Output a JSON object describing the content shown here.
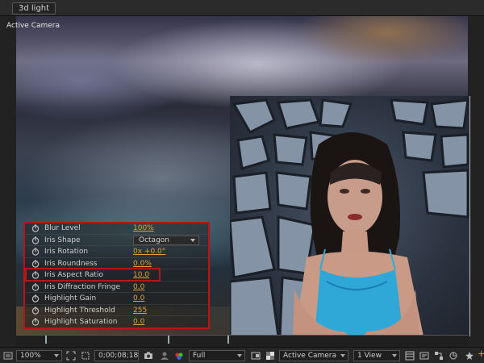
{
  "composition_tab": "3d light",
  "viewer": {
    "camera_label": "Active Camera"
  },
  "effects": [
    {
      "label": "Blur Level",
      "value": "100%",
      "type": "value"
    },
    {
      "label": "Iris Shape",
      "value": "Octagon",
      "type": "dropdown"
    },
    {
      "label": "Iris Rotation",
      "value": "0x +0.0°",
      "type": "value"
    },
    {
      "label": "Iris Roundness",
      "value": "0.0%",
      "type": "value"
    },
    {
      "label": "Iris Aspect Ratio",
      "value": "10.0",
      "type": "value"
    },
    {
      "label": "Iris Diffraction Fringe",
      "value": "0.0",
      "type": "value"
    },
    {
      "label": "Highlight Gain",
      "value": "0.0",
      "type": "value"
    },
    {
      "label": "Highlight Threshold",
      "value": "255",
      "type": "value"
    },
    {
      "label": "Highlight Saturation",
      "value": "0.0",
      "type": "value"
    }
  ],
  "toolbar": {
    "zoom": "100%",
    "timecode": "0;00;08;18",
    "resolution": "Full",
    "view": "Active Camera",
    "layout": "1 View"
  },
  "colors": {
    "accent_value": "#e0a436",
    "highlight_box": "#b3161b"
  }
}
